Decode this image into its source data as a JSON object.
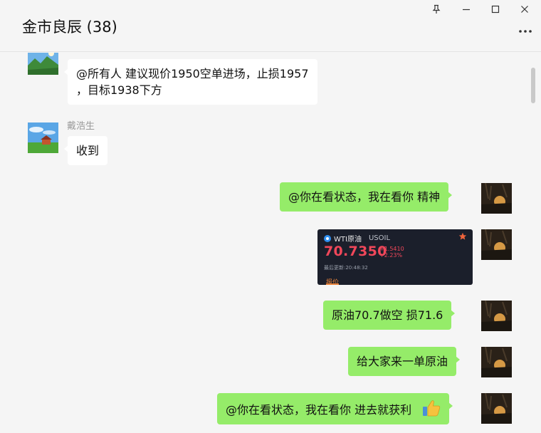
{
  "window": {
    "title": "金市良辰 (38)",
    "controls": [
      "pin-icon",
      "minimize-icon",
      "maximize-icon",
      "close-icon"
    ],
    "more_icon": "more-icon"
  },
  "colors": {
    "background": "#f5f5f5",
    "incoming_bubble": "#ffffff",
    "outgoing_bubble": "#95ec69",
    "quote_card_bg": "#1b1f2b",
    "price_red": "#f0475a",
    "tab_orange": "#e8823a"
  },
  "messages": [
    {
      "direction": "incoming",
      "lines": [
        "@所有人 建议现价1950空单进场，止损1957",
        "，目标1938下方"
      ]
    },
    {
      "direction": "incoming",
      "sender": "戴浩生",
      "lines": [
        "收到"
      ]
    },
    {
      "direction": "outgoing",
      "lines": [
        "@你在看状态，我在看你 精神"
      ]
    },
    {
      "direction": "outgoing",
      "type": "image",
      "quote_card": {
        "name": "WTI原油",
        "symbol": "USOIL",
        "price": "70.7350",
        "change": "+1.5410",
        "change_pct": "+2.23%",
        "updated": "最后更新:20:48:32",
        "tab": "报价"
      }
    },
    {
      "direction": "outgoing",
      "lines": [
        "原油70.7做空 损71.6"
      ]
    },
    {
      "direction": "outgoing",
      "lines": [
        "给大家来一单原油"
      ]
    },
    {
      "direction": "outgoing",
      "lines": [
        "@你在看状态，我在看你 进去就获利"
      ],
      "emoji": "thumbs-up-icon"
    }
  ]
}
